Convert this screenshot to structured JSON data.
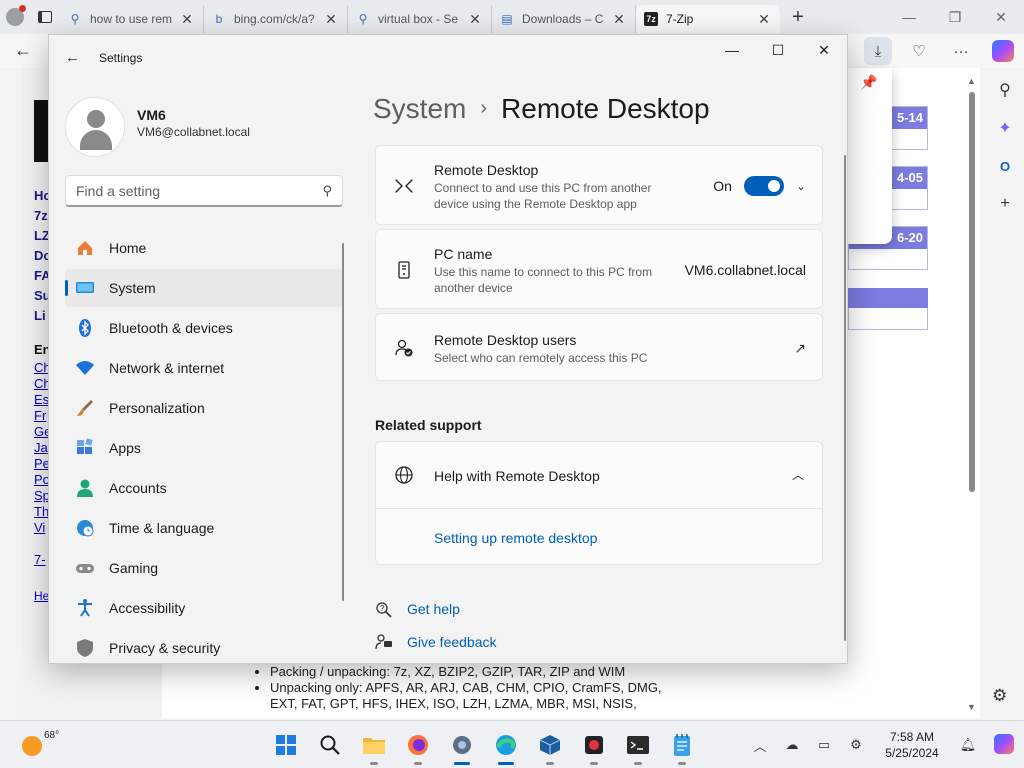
{
  "browser": {
    "tabs": [
      {
        "label": "how to use rem",
        "icon": "search-icon",
        "glyph": "⚲"
      },
      {
        "label": "bing.com/ck/a?",
        "icon": "bing-icon",
        "glyph": "b"
      },
      {
        "label": "virtual box - Se",
        "icon": "search-icon",
        "glyph": "⚲"
      },
      {
        "label": "Downloads – C",
        "icon": "downloads-icon",
        "glyph": "▤"
      },
      {
        "label": "7-Zip",
        "icon": "7zip-icon",
        "glyph": "7z"
      }
    ]
  },
  "webpage": {
    "nav_bold": [
      "Ho",
      "7z",
      "LZ",
      "Do",
      "FA",
      "Su",
      "Li"
    ],
    "nav_en": "En",
    "nav_links": [
      "Ch",
      "Ch",
      "Es",
      "Fr",
      "Ge",
      "Ja",
      "Pe",
      "Po",
      "Sp",
      "Th",
      "Vi"
    ],
    "nav_bottom": [
      "7-",
      "He"
    ],
    "date_badges": [
      "5-14",
      "4-05",
      "6-20"
    ],
    "bullets": [
      "Packing / unpacking: 7z, XZ, BZIP2, GZIP, TAR, ZIP and WIM",
      "Unpacking only: APFS, AR, ARJ, CAB, CHM, CPIO, CramFS, DMG,",
      "EXT, FAT, GPT, HFS, IHEX, ISO, LZH, LZMA, MBR, MSI, NSIS,"
    ]
  },
  "settings": {
    "window_title": "Settings",
    "user": {
      "name": "VM6",
      "email": "VM6@collabnet.local"
    },
    "search_placeholder": "Find a setting",
    "nav": [
      {
        "label": "Home",
        "icon": "home-icon"
      },
      {
        "label": "System",
        "icon": "system-icon",
        "selected": true
      },
      {
        "label": "Bluetooth & devices",
        "icon": "bluetooth-icon"
      },
      {
        "label": "Network & internet",
        "icon": "wifi-icon"
      },
      {
        "label": "Personalization",
        "icon": "brush-icon"
      },
      {
        "label": "Apps",
        "icon": "apps-icon"
      },
      {
        "label": "Accounts",
        "icon": "accounts-icon"
      },
      {
        "label": "Time & language",
        "icon": "globe-clock-icon"
      },
      {
        "label": "Gaming",
        "icon": "gamepad-icon"
      },
      {
        "label": "Accessibility",
        "icon": "accessibility-icon"
      },
      {
        "label": "Privacy & security",
        "icon": "shield-icon"
      }
    ],
    "breadcrumb": {
      "parent": "System",
      "separator": "›",
      "current": "Remote Desktop"
    },
    "remote_desktop": {
      "title": "Remote Desktop",
      "desc": "Connect to and use this PC from another device using the Remote Desktop app",
      "state": "On"
    },
    "pc_name": {
      "title": "PC name",
      "desc": "Use this name to connect to this PC from another device",
      "value": "VM6.collabnet.local"
    },
    "rd_users": {
      "title": "Remote Desktop users",
      "desc": "Select who can remotely access this PC"
    },
    "related_support": "Related support",
    "help": {
      "title": "Help with Remote Desktop",
      "link": "Setting up remote desktop"
    },
    "get_help": "Get help",
    "give_feedback": "Give feedback"
  },
  "taskbar": {
    "temperature": "68°",
    "time": "7:58 AM",
    "date": "5/25/2024"
  }
}
